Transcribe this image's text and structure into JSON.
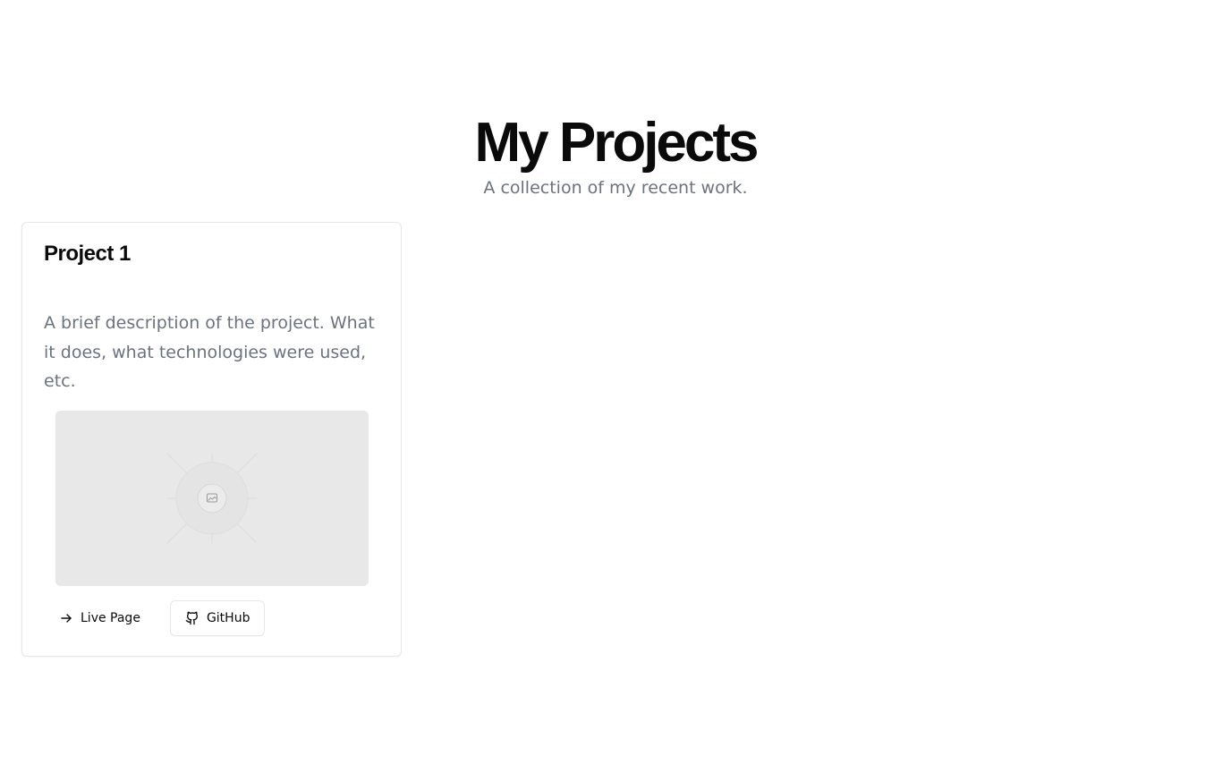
{
  "header": {
    "title": "My Projects",
    "subtitle": "A collection of my recent work."
  },
  "projects": [
    {
      "title": "Project 1",
      "description": "A brief description of the project. What it does, what technologies were used, etc.",
      "image_icon": "image-placeholder-icon",
      "live_label": "Live Page",
      "live_icon": "arrow-right-icon",
      "github_label": "GitHub",
      "github_icon": "github-icon"
    }
  ],
  "colors": {
    "title": "#0a0a0a",
    "muted_text": "#6b7280",
    "border": "#e5e7eb",
    "placeholder_bg": "#e8e8e8"
  }
}
